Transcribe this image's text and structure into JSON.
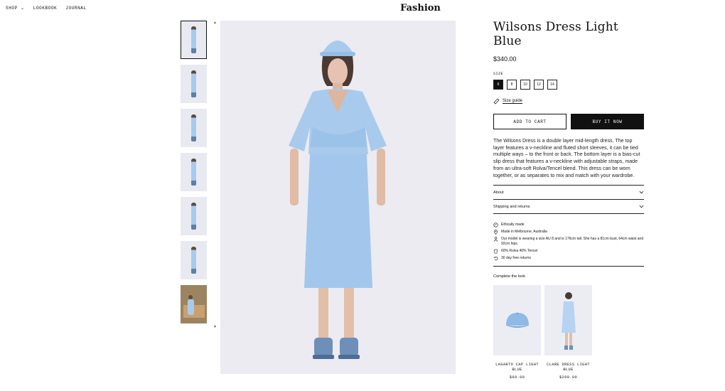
{
  "nav": {
    "shop": "SHOP",
    "lookbook": "LOOKBOOK",
    "journal": "JOURNAL"
  },
  "brand": "Fashion",
  "product": {
    "title": "Wilsons Dress Light Blue",
    "price": "$340.00",
    "size_label": "SIZE",
    "sizes": [
      "6",
      "8",
      "10",
      "12",
      "14"
    ],
    "selected_size": "6",
    "size_guide": "Size guide",
    "add_to_cart": "ADD TO CART",
    "buy_now": "BUY IT NOW",
    "description": "The Wilsons Dress is a double layer mid-length dress. The top layer features a v-neckline and fluted short sleeves, it can be tied multiple ways – to the front or back. The bottom layer is a bias-cut slip dress that features a v-neckline with adjustable straps, made from an ultra-soft Rolva/Tencel blend. This dress can be worn together, or as separates to mix and match with your wardrobe.",
    "accordions": [
      "About",
      "Shipping and returns"
    ],
    "features": [
      {
        "icon": "leaf-icon",
        "text": "Ethically made"
      },
      {
        "icon": "location-pin-icon",
        "text": "Made in Melbourne, Australia"
      },
      {
        "icon": "person-icon",
        "text": "Our model is wearing a size AU 8 and is 176cm tall. She has a 81cm bust, 64cm waist and 92cm hips."
      },
      {
        "icon": "shirt-icon",
        "text": "60% Rolva 40% Tencel"
      },
      {
        "icon": "return-arrow-icon",
        "text": "30 day free returns"
      }
    ]
  },
  "complete_look": {
    "title": "Complete the look",
    "items": [
      {
        "name": "LAGARTO CAP LIGHT BLUE",
        "price": "$60.00"
      },
      {
        "name": "CLARE DRESS LIGHT BLUE",
        "price": "$299.00"
      }
    ]
  },
  "colors": {
    "dress": "#a8cbed",
    "background": "#ecedf3",
    "accent": "#111111"
  }
}
